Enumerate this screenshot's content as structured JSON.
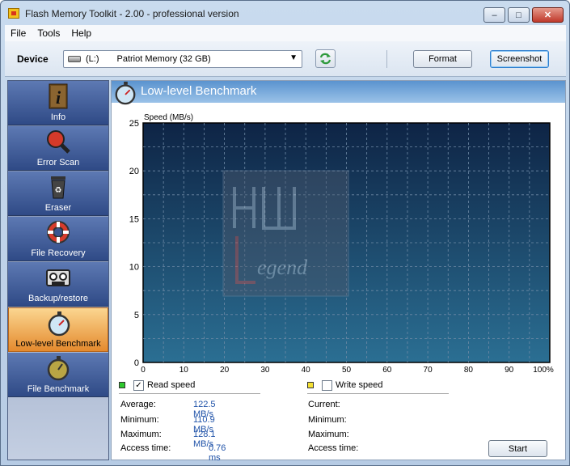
{
  "window": {
    "title": "Flash Memory Toolkit - 2.00 - professional version",
    "min": "–",
    "max": "□",
    "close": "✕"
  },
  "menu": [
    "File",
    "Tools",
    "Help"
  ],
  "toolbar": {
    "device_label": "Device",
    "drive_letter": "(L:)",
    "drive_name": "Patriot Memory (32 GB)",
    "chev": "▼",
    "format_label": "Format",
    "screenshot_label": "Screenshot"
  },
  "sidebar": {
    "items": [
      {
        "label": "Info",
        "icon": "info-icon",
        "active": false
      },
      {
        "label": "Error Scan",
        "icon": "magnifier-icon",
        "active": false
      },
      {
        "label": "Eraser",
        "icon": "recycle-bin-icon",
        "active": false
      },
      {
        "label": "File Recovery",
        "icon": "life-ring-icon",
        "active": false
      },
      {
        "label": "Backup/restore",
        "icon": "tape-icon",
        "active": false
      },
      {
        "label": "Low-level Benchmark",
        "icon": "stopwatch-icon",
        "active": true
      },
      {
        "label": "File Benchmark",
        "icon": "stopwatch-icon",
        "active": false
      }
    ]
  },
  "header": {
    "title": "Low-level Benchmark"
  },
  "chart_data": {
    "type": "line",
    "ylabel": "Speed (MB/s)",
    "xlabel": "",
    "ylim": [
      0,
      25
    ],
    "xlim": [
      0,
      100
    ],
    "yticks": [
      "0",
      "5",
      "10",
      "15",
      "20",
      "25"
    ],
    "xticks": [
      "0",
      "10",
      "20",
      "30",
      "40",
      "50",
      "60",
      "70",
      "80",
      "90",
      "100%"
    ],
    "grid": true,
    "series": [
      {
        "name": "Read speed",
        "color": "#33cc33",
        "values": []
      },
      {
        "name": "Write speed",
        "color": "#ffe033",
        "values": []
      }
    ]
  },
  "read": {
    "label": "Read speed",
    "checked": "✓",
    "color": "#2ec82e",
    "stats": [
      {
        "label": "Average:",
        "value": "122.5 MB/s"
      },
      {
        "label": "Minimum:",
        "value": "110.9 MB/s"
      },
      {
        "label": "Maximum:",
        "value": "128.1 MB/s"
      },
      {
        "label": "Access time:",
        "value": "0.76 ms"
      }
    ]
  },
  "write": {
    "label": "Write speed",
    "color": "#f4e033",
    "stats": [
      {
        "label": "Current:",
        "value": ""
      },
      {
        "label": "Minimum:",
        "value": ""
      },
      {
        "label": "Maximum:",
        "value": ""
      },
      {
        "label": "Access time:",
        "value": ""
      }
    ]
  },
  "start_label": "Start"
}
